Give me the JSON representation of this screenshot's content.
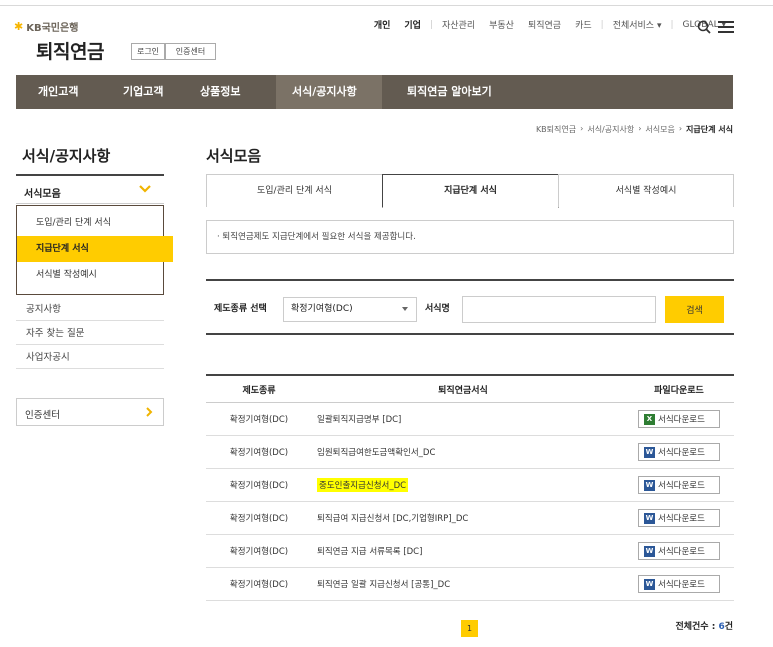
{
  "brand": {
    "logo_text": "KB국민은행",
    "site_title": "퇴직연금",
    "login_button": "로그인",
    "cert_button": "인증센터"
  },
  "gnb": {
    "items": [
      "개인",
      "기업"
    ],
    "links": [
      "자산관리",
      "부동산",
      "퇴직연금",
      "카드"
    ],
    "all_services": "전체서비스 ▾",
    "global": "GLOBAL ▾"
  },
  "nav": {
    "items": [
      "개인고객",
      "기업고객",
      "상품정보",
      "서식/공지사항",
      "퇴직연금 알아보기"
    ],
    "active": "서식/공지사항"
  },
  "breadcrumb": [
    "KB퇴직연금",
    "서식/공지사항",
    "서식모음",
    "지급단계 서식"
  ],
  "sidebar": {
    "title": "서식/공지사항",
    "selected": "서식모음",
    "submenu": [
      "도입/관리 단계 서식",
      "지급단계 서식",
      "서식별 작성예시"
    ],
    "submenu_active": "지급단계 서식",
    "links": [
      "공지사항",
      "자주 찾는 질문",
      "사업자공시"
    ],
    "cert": "인증센터"
  },
  "main": {
    "title": "서식모음",
    "tabs": [
      "도입/관리 단계 서식",
      "지급단계 서식",
      "서식별 작성예시"
    ],
    "active_tab": "지급단계 서식",
    "notice": "· 퇴직연금제도 지급단계에서 필요한 서식을 제공합니다.",
    "search": {
      "type_label": "제도종류 선택",
      "type_value": "확정기여형(DC)",
      "name_label": "서식명",
      "name_value": "",
      "button": "검색"
    },
    "table": {
      "headers": [
        "제도종류",
        "퇴직연금서식",
        "파일다운로드"
      ],
      "rows": [
        {
          "type": "확정기여형(DC)",
          "name": "일괄퇴직지급명부 [DC]",
          "file": "excel",
          "highlight": false
        },
        {
          "type": "확정기여형(DC)",
          "name": "임원퇴직급여한도금액확인서_DC",
          "file": "word",
          "highlight": false
        },
        {
          "type": "확정기여형(DC)",
          "name": "중도인출지급신청서_DC",
          "file": "word",
          "highlight": true
        },
        {
          "type": "확정기여형(DC)",
          "name": "퇴직급여 지급신청서 [DC,기업형IRP]_DC",
          "file": "word",
          "highlight": false
        },
        {
          "type": "확정기여형(DC)",
          "name": "퇴직연금 지급 서류목록 [DC]",
          "file": "word",
          "highlight": false
        },
        {
          "type": "확정기여형(DC)",
          "name": "퇴직연금 일괄 지급신청서 [공통]_DC",
          "file": "word",
          "highlight": false
        }
      ],
      "download_label": "서식다운로드"
    },
    "pager": {
      "current": "1"
    },
    "total": {
      "label": "전체건수 :",
      "count": "6",
      "unit": "건"
    }
  },
  "colors": {
    "nav_bg": "#635b51",
    "accent": "#ffcc00",
    "highlight": "#ffff00"
  }
}
